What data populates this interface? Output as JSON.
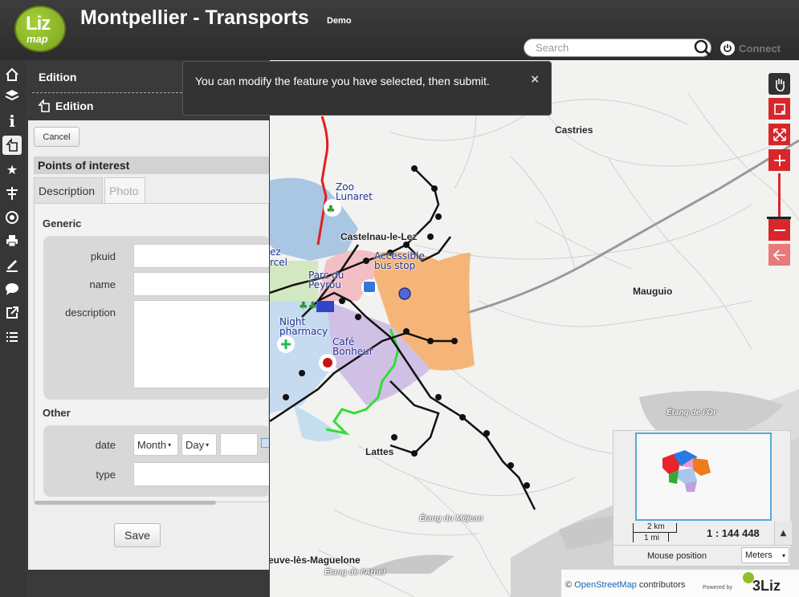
{
  "header": {
    "logo_top": "Liz",
    "logo_bottom": "map",
    "title": "Montpellier - Transports",
    "subtitle": "Demo",
    "search_placeholder": "Search",
    "connect_label": "Connect"
  },
  "mapmenu": {
    "icons": [
      "home-icon",
      "layers-icon",
      "info-icon",
      "edition-icon",
      "star-icon",
      "locate-icon",
      "geolocation-icon",
      "print-icon",
      "measure-icon",
      "tooltip-icon",
      "permalink-icon",
      "list-icon"
    ]
  },
  "dock": {
    "title": "Edition",
    "subtitle": "Edition",
    "cancel_label": "Cancel",
    "layer_title": "Points of interest",
    "tabs": [
      "Description",
      "Photo"
    ],
    "groups": {
      "generic": "Generic",
      "other": "Other"
    },
    "fields": {
      "pkuid": "pkuid",
      "name": "name",
      "description": "description",
      "date": "date",
      "type": "type"
    },
    "date_month": "Month",
    "date_day": "Day",
    "save_label": "Save"
  },
  "notification": {
    "message": "You can modify the feature you have selected, then submit.",
    "close": "×"
  },
  "map": {
    "places": [
      "Castries",
      "Castelnau-le-Lez",
      "Mauguio",
      "Lattes",
      "euve-lès-Maguelone"
    ],
    "water": [
      "Étang de l'Or",
      "Étang du Méjean",
      "Étang de l'Arnel"
    ],
    "pois": [
      "Zoo Lunaret",
      "Accessible bus stop",
      "Parc du Peyrou",
      "Night pharmacy",
      "Café Bonheur",
      "rcel",
      "ez"
    ]
  },
  "overview": {
    "scale_km": "2 km",
    "scale_mi": "1 mi",
    "scale": "1 : 144 448",
    "mouse_position": "Mouse position",
    "units": "Meters"
  },
  "attribution": {
    "prefix": "©",
    "link": "OpenStreetMap",
    "suffix": "contributors",
    "powered": "Powered by",
    "brand": "3Liz"
  },
  "colors": {
    "accent_red": "#d9262b",
    "logo_green": "#8fbf2a",
    "panel_bg": "#eeeeee"
  }
}
